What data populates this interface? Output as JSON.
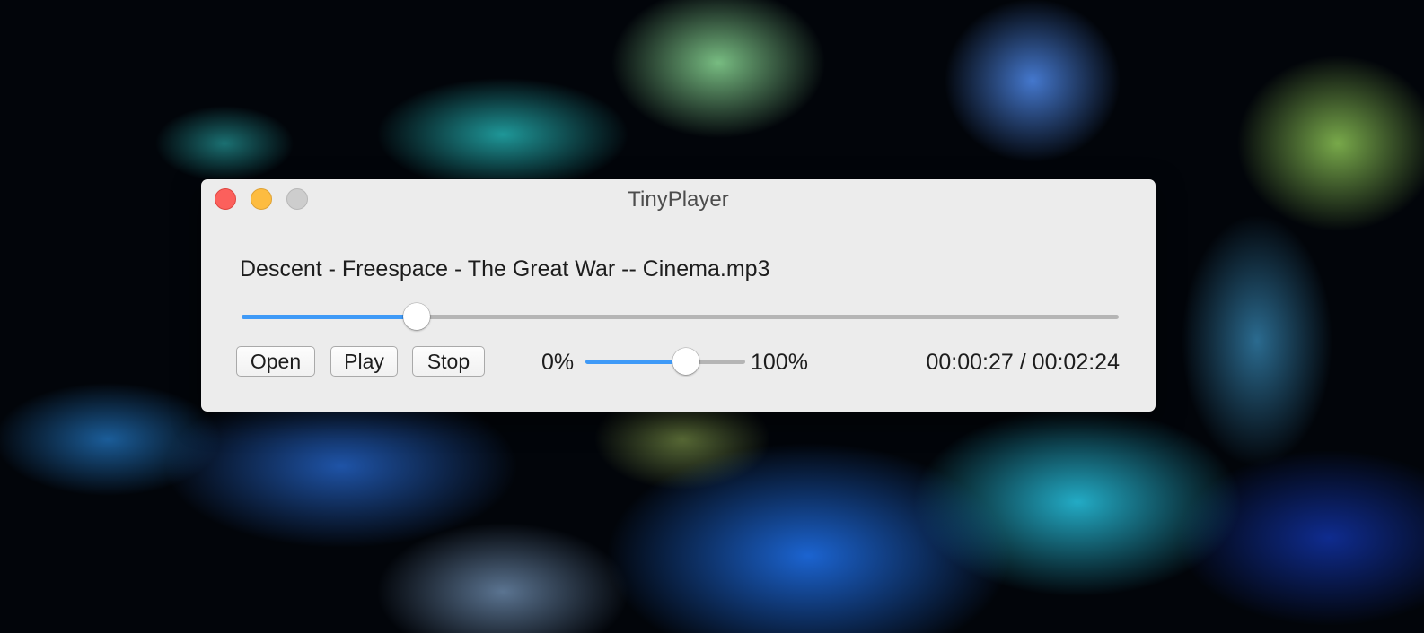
{
  "window": {
    "title": "TinyPlayer"
  },
  "player": {
    "track_name": "Descent - Freespace - The Great War -- Cinema.mp3",
    "progress": 0.2,
    "volume": 0.63,
    "volume_min_label": "0%",
    "volume_max_label": "100%",
    "elapsed": "00:00:27",
    "separator": "/",
    "total": "00:02:24"
  },
  "buttons": {
    "open_label": "Open",
    "play_label": "Play",
    "stop_label": "Stop"
  },
  "colors": {
    "accent": "#3f9af7",
    "close": "#fc605c",
    "minimize": "#fdbc40",
    "zoom_inactive": "#cdcdcd",
    "window_bg": "#ececec"
  },
  "icons": {
    "close": "close-button",
    "minimize": "minimize-button",
    "zoom": "zoom-button"
  }
}
